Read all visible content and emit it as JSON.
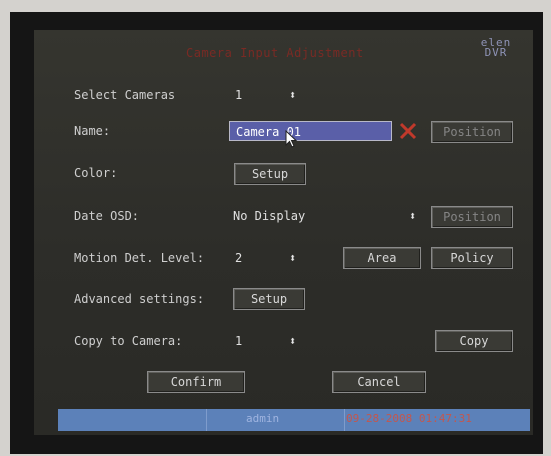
{
  "dialog": {
    "title": "Camera Input Adjustment",
    "brand": "elen\nDVR"
  },
  "rows": {
    "select_camera": {
      "label": "Select Cameras",
      "value": "1"
    },
    "name": {
      "label": "Name:",
      "value": "Camera 01",
      "position_button": "Position"
    },
    "color": {
      "label": "Color:",
      "setup_button": "Setup"
    },
    "date_osd": {
      "label": "Date OSD:",
      "value": "No Display",
      "position_button": "Position"
    },
    "motion": {
      "label": "Motion Det. Level:",
      "value": "2",
      "area_button": "Area",
      "policy_button": "Policy"
    },
    "advanced": {
      "label": "Advanced settings:",
      "setup_button": "Setup"
    },
    "copy": {
      "label": "Copy to Camera:",
      "value": "1",
      "copy_button": "Copy"
    }
  },
  "actions": {
    "confirm": "Confirm",
    "cancel": "Cancel"
  },
  "status_bar": {
    "user": "admin",
    "datetime": "09-28-2008 01:47:31"
  },
  "colors": {
    "title": "#7a2a24",
    "panel": "#2f2f2b",
    "selected_field": "#5a5fa8",
    "status_bar": "#5c81b9",
    "datetime": "#c3574e",
    "clear_icon": "#c0392b"
  },
  "icons": {
    "spinner": "up-down-arrows-icon",
    "clear": "red-x-icon",
    "pointer": "mouse-cursor-icon"
  }
}
